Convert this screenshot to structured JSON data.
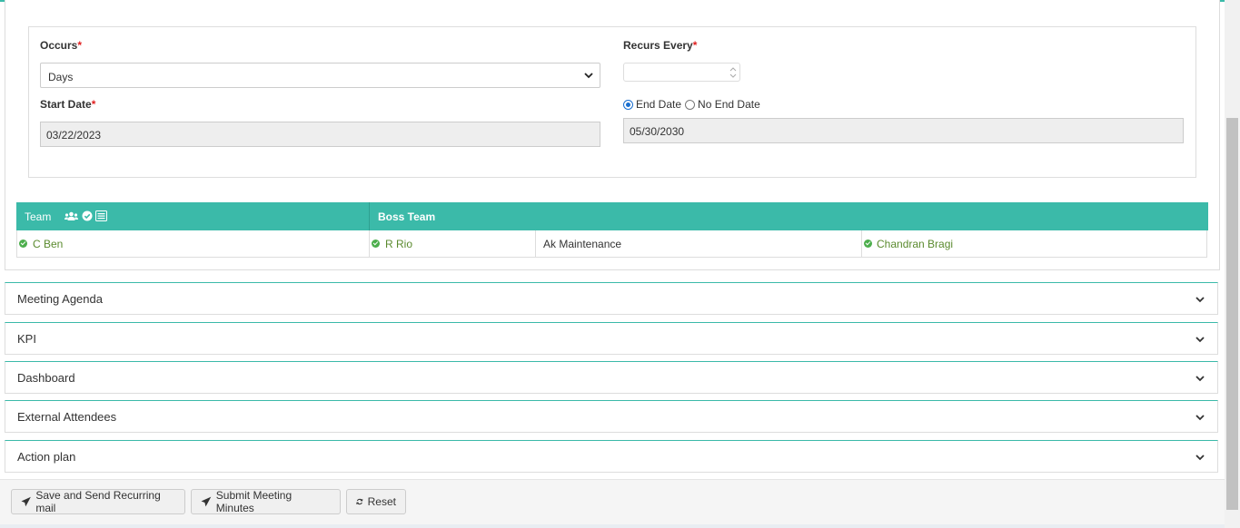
{
  "schedule": {
    "occurs_label": "Occurs",
    "occurs_value": "Days",
    "recurs_label": "Recurs Every",
    "recurs_value": "",
    "required_mark": "*",
    "start_date_label": "Start Date",
    "start_date_value": "03/22/2023",
    "end_option": "End Date",
    "no_end_option": "No End Date",
    "end_date_value": "05/30/2030"
  },
  "team_table": {
    "team_header": "Team",
    "boss_header": "Boss Team",
    "team_member": "C Ben",
    "boss_member": "R Rio",
    "boss_role": "Ak Maintenance",
    "other_member": "Chandran Bragi"
  },
  "sections": [
    {
      "label": "Meeting Agenda"
    },
    {
      "label": "KPI"
    },
    {
      "label": "Dashboard"
    },
    {
      "label": "External Attendees"
    },
    {
      "label": "Action plan"
    }
  ],
  "buttons": {
    "save_send": "Save and Send Recurring mail",
    "submit": "Submit Meeting Minutes",
    "reset": "Reset"
  },
  "colors": {
    "accent": "#3bbaa9",
    "required": "#e02020",
    "member_text": "#5a8a2e",
    "check": "#4cae4c"
  }
}
